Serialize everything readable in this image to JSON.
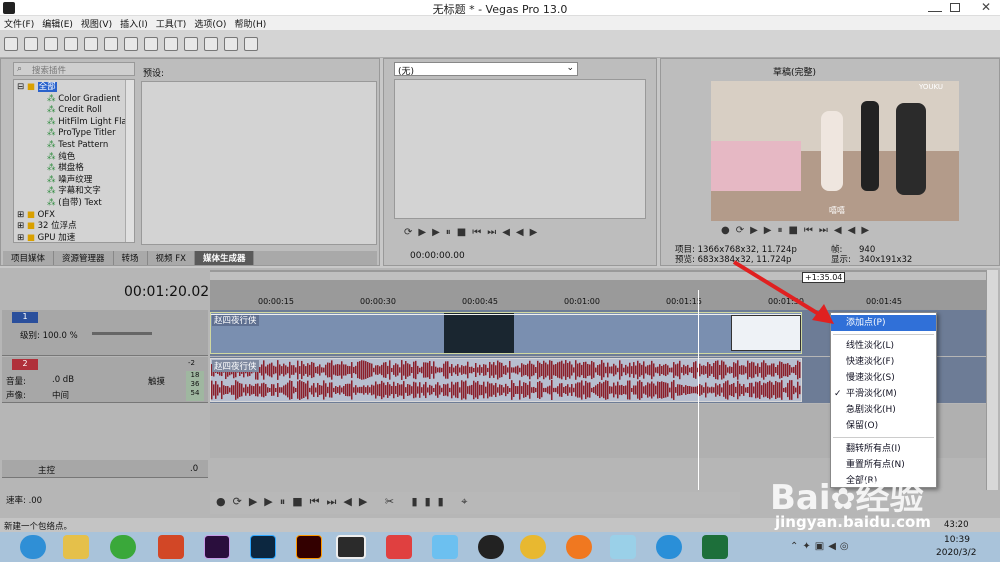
{
  "window": {
    "title": "无标题 * - Vegas Pro 13.0"
  },
  "menu": [
    "文件(F)",
    "编辑(E)",
    "视图(V)",
    "插入(I)",
    "工具(T)",
    "选项(O)",
    "帮助(H)"
  ],
  "explorer": {
    "search_placeholder": "搜索插件",
    "preset_label": "预设:",
    "tree": [
      "全部",
      "Color Gradient",
      "Credit Roll",
      "HitFilm Light Fla",
      "ProType Titler",
      "Test Pattern",
      "纯色",
      "棋盘格",
      "噪声纹理",
      "字幕和文字",
      "(自带) Text",
      "OFX",
      "32 位浮点",
      "GPU 加速"
    ],
    "tabs": [
      "项目媒体",
      "资源管理器",
      "转场",
      "视频 FX",
      "媒体生成器"
    ]
  },
  "trimmer": {
    "dropdown": "(无)",
    "timecode": "00:00:00.00"
  },
  "preview": {
    "quality": "草稿(完整)",
    "project_label": "项目:",
    "project_value": "1366x768x32, 11.724p",
    "preview_label": "预览:",
    "preview_value": "683x384x32, 11.724p",
    "frame_label": "帧:",
    "frame_value": "940",
    "display_label": "显示:",
    "display_value": "340x191x32",
    "watermark": "YOUKU",
    "subtitle": "嘻嘻"
  },
  "timeline": {
    "current_time": "00:01:20.02",
    "region_marker": "+1:35.04",
    "ruler": [
      "00:00:15",
      "00:00:30",
      "00:00:45",
      "00:01:00",
      "00:01:15",
      "00:01:30",
      "00:01:45"
    ],
    "video_track": {
      "number": "1",
      "level_label": "级别: 100.0 %",
      "clip": "赵四夜行侠"
    },
    "audio_track": {
      "number": "2",
      "volume_label": "音量:",
      "volume_value": ".0 dB",
      "pan_label": "声像:",
      "pan_value": "中间",
      "mode": "触摸",
      "meter": [
        "18",
        "36",
        "54"
      ],
      "meter_top": "-2",
      "clip": "赵四夜行侠"
    },
    "master": {
      "label": "主控",
      "value": ".0"
    },
    "rate_label": "速率: .00",
    "end_time": "43:20"
  },
  "context_menu": {
    "items": [
      "添加点(P)",
      "线性淡化(L)",
      "快速淡化(F)",
      "慢速淡化(S)",
      "平滑淡化(M)",
      "急剧淡化(H)",
      "保留(O)",
      "翻转所有点(I)",
      "重置所有点(N)",
      "全部(R)"
    ],
    "checked": "平滑淡化(M)",
    "highlight": "添加点(P)"
  },
  "status": {
    "text": "新建一个包络点。"
  },
  "taskbar": {
    "time": "10:39",
    "date": "2020/3/2"
  },
  "watermark": {
    "brand": "Bai",
    "brand_tail": "经验",
    "url": "jingyan.baidu.com"
  },
  "colors": {
    "accent": "#3070d8",
    "video_lane": "#6d7c96",
    "audio_wave": "#8b1f2a",
    "arrow": "#e02020",
    "track2": "#c03840"
  }
}
